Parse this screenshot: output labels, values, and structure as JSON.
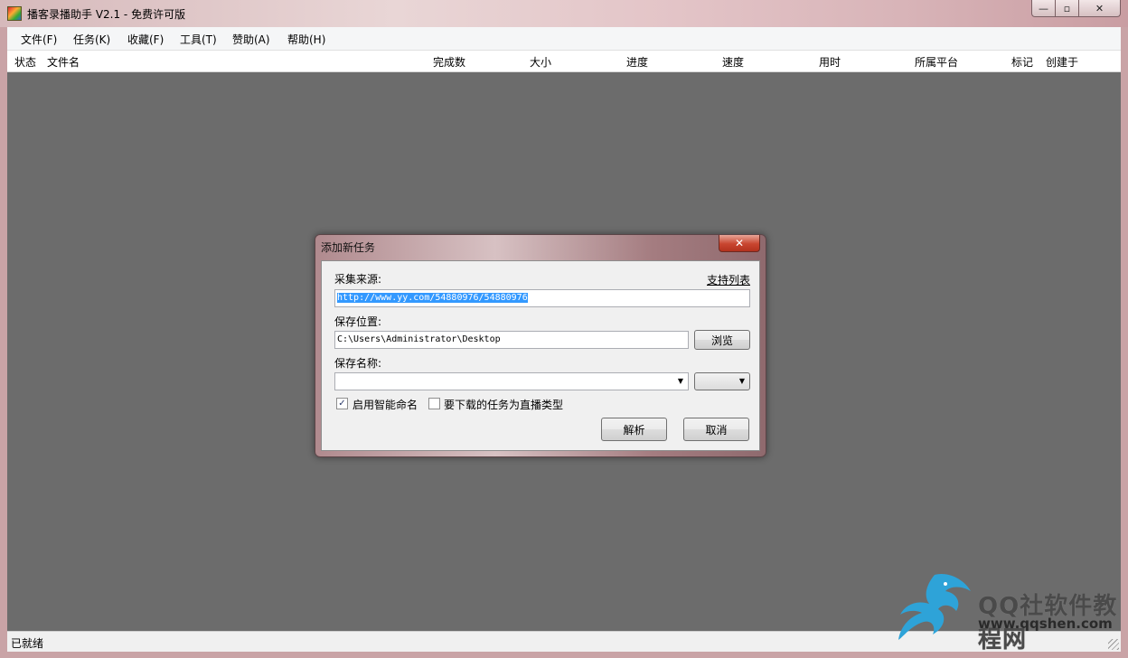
{
  "window": {
    "title": "播客录播助手 V2.1 - 免费许可版",
    "min_glyph": "—",
    "max_glyph": "▫",
    "close_glyph": "✕"
  },
  "menu": [
    "文件(F)",
    "任务(K)",
    "收藏(F)",
    "工具(T)",
    "赞助(A)",
    "帮助(H)"
  ],
  "columns": [
    "状态",
    "文件名",
    "完成数",
    "大小",
    "进度",
    "速度",
    "用时",
    "所属平台",
    "标记",
    "创建于"
  ],
  "status": "已就绪",
  "dialog": {
    "title": "添加新任务",
    "close_glyph": "✕",
    "source_label": "采集来源:",
    "support_link": "支持列表",
    "source_url": "http://www.yy.com/54880976/54880976",
    "save_location_label": "保存位置:",
    "save_path": "C:\\Users\\Administrator\\Desktop",
    "browse_button": "浏览",
    "save_name_label": "保存名称:",
    "save_name_value": "",
    "format_value": "",
    "smart_naming_label": "启用智能命名",
    "smart_naming_checked": true,
    "live_type_label": "要下载的任务为直播类型",
    "live_type_checked": false,
    "parse_button": "解析",
    "cancel_button": "取消"
  },
  "watermark": {
    "title": "QQ社软件教程网",
    "url": "www.qqshen.com"
  }
}
